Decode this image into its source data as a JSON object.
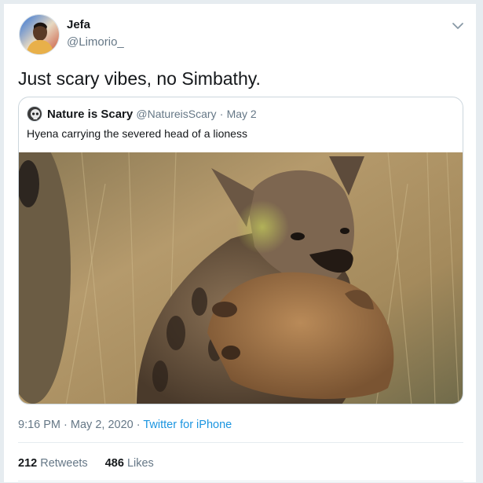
{
  "user": {
    "display_name": "Jefa",
    "handle": "@Limorio_",
    "avatar_icon": "profile-avatar"
  },
  "tweet": {
    "text": "Just scary vibes, no Simbathy."
  },
  "quoted_tweet": {
    "display_name": "Nature is Scary",
    "handle": "@NatureisScary",
    "separator": "·",
    "date": "May 2",
    "text": "Hyena carrying the severed head of a lioness",
    "image_icon": "hyena-photo"
  },
  "meta": {
    "time": "9:16 PM",
    "separator_1": "·",
    "date": "May 2, 2020",
    "separator_2": "·",
    "source": "Twitter for iPhone"
  },
  "stats": {
    "retweets_count": "212",
    "retweets_label": "Retweets",
    "likes_count": "486",
    "likes_label": "Likes"
  },
  "colors": {
    "link": "#1b95e0",
    "secondary_text": "#657786",
    "border": "#ccd6dd"
  }
}
